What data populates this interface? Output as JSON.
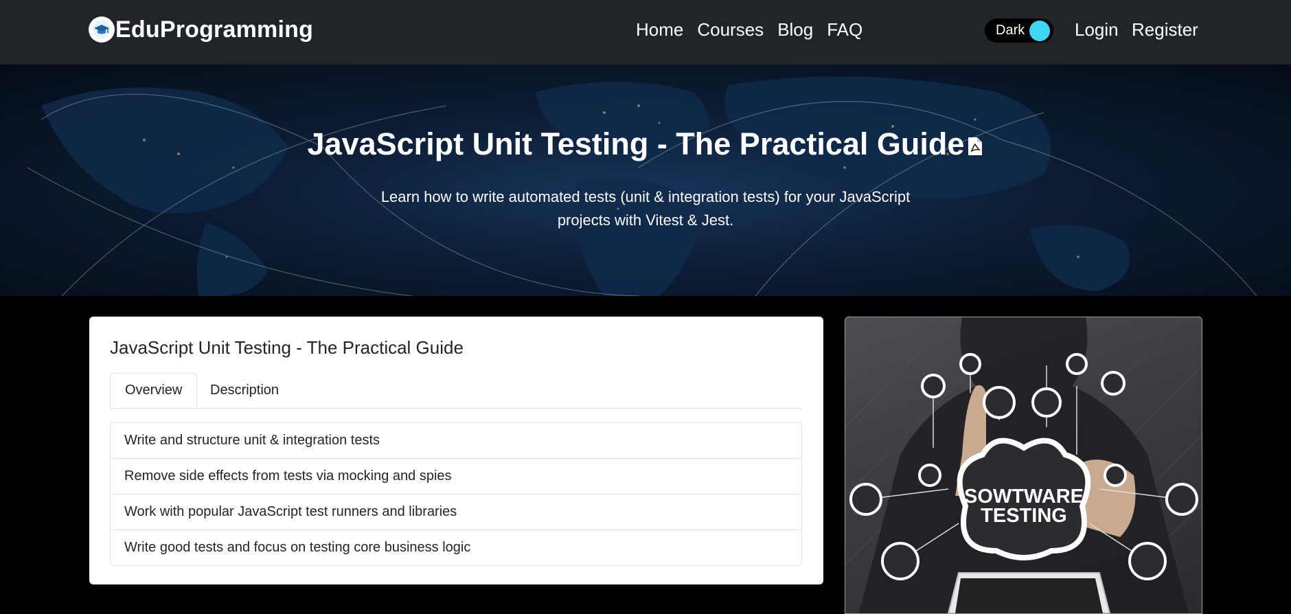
{
  "brand": {
    "name": "EduProgramming"
  },
  "nav": {
    "items": [
      "Home",
      "Courses",
      "Blog",
      "FAQ"
    ]
  },
  "theme_toggle": {
    "label": "Dark",
    "knob_color": "#3fd6f5"
  },
  "auth": {
    "login": "Login",
    "register": "Register"
  },
  "hero": {
    "title": "JavaScript Unit Testing - The Practical Guide",
    "subtitle": "Learn how to write automated tests (unit & integration tests) for your JavaScript projects with Vitest & Jest."
  },
  "course_card": {
    "title": "JavaScript Unit Testing - The Practical Guide",
    "tabs": [
      "Overview",
      "Description"
    ],
    "active_tab": "Overview",
    "overview_items": [
      "Write and structure unit & integration tests",
      "Remove side effects from tests via mocking and spies",
      "Work with popular JavaScript test runners and libraries",
      "Write good tests and focus on testing core business logic"
    ]
  },
  "course_image": {
    "line1": "SOWTWARE",
    "line2": "TESTING"
  },
  "colors": {
    "navbar": "#212529",
    "accent": "#3fd6f5",
    "page_bg": "#000000"
  }
}
